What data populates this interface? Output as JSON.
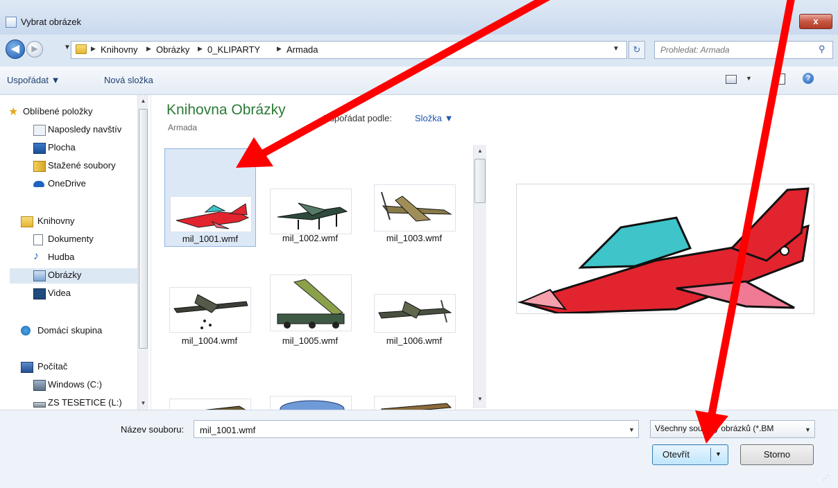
{
  "window": {
    "title": "Vybrat obrázek",
    "close_glyph": "x",
    "accent": "#1e5db3"
  },
  "address": {
    "breadcrumbs": [
      "Knihovny",
      "Obrázky",
      "0_KLIPARTY",
      "Armada"
    ],
    "search_placeholder": "Prohledat: Armada"
  },
  "toolbar": {
    "organize_label": "Uspořádat ▼",
    "new_folder_label": "Nová složka"
  },
  "nav": {
    "items": [
      {
        "label": "Oblíbené položky",
        "icon": "star-icon"
      },
      {
        "label": "Naposledy navštív",
        "icon": "recent-places-icon"
      },
      {
        "label": "Plocha",
        "icon": "desktop-icon"
      },
      {
        "label": "Stažené soubory",
        "icon": "downloads-icon"
      },
      {
        "label": "OneDrive",
        "icon": "onedrive-icon"
      },
      {
        "label": "Knihovny",
        "icon": "libraries-icon"
      },
      {
        "label": "Dokumenty",
        "icon": "documents-icon"
      },
      {
        "label": "Hudba",
        "icon": "music-icon"
      },
      {
        "label": "Obrázky",
        "icon": "pictures-icon",
        "selected": true
      },
      {
        "label": "Videa",
        "icon": "videos-icon"
      },
      {
        "label": "Domácí skupina",
        "icon": "homegroup-icon"
      },
      {
        "label": "Počítač",
        "icon": "computer-icon"
      },
      {
        "label": "Windows (C:)",
        "icon": "drive-icon"
      },
      {
        "label": "ZS TESETICE (L:)",
        "icon": "network-drive-icon"
      }
    ]
  },
  "content": {
    "library_title": "Knihovna Obrázky",
    "library_subtitle": "Armada",
    "arrange_label": "Uspořádat podle:",
    "arrange_value": "Složka ▼",
    "files": [
      {
        "name": "mil_1001.wmf",
        "selected": true
      },
      {
        "name": "mil_1002.wmf"
      },
      {
        "name": "mil_1003.wmf"
      },
      {
        "name": "mil_1004.wmf"
      },
      {
        "name": "mil_1005.wmf"
      },
      {
        "name": "mil_1006.wmf"
      }
    ]
  },
  "bottom": {
    "filename_label": "Název souboru:",
    "filename_value": "mil_1001.wmf",
    "filter_value": "Všechny soubory obrázků (*.BM",
    "open_label": "Otevřít",
    "cancel_label": "Storno"
  },
  "annotation": {
    "arrow_color": "#ff0000"
  }
}
